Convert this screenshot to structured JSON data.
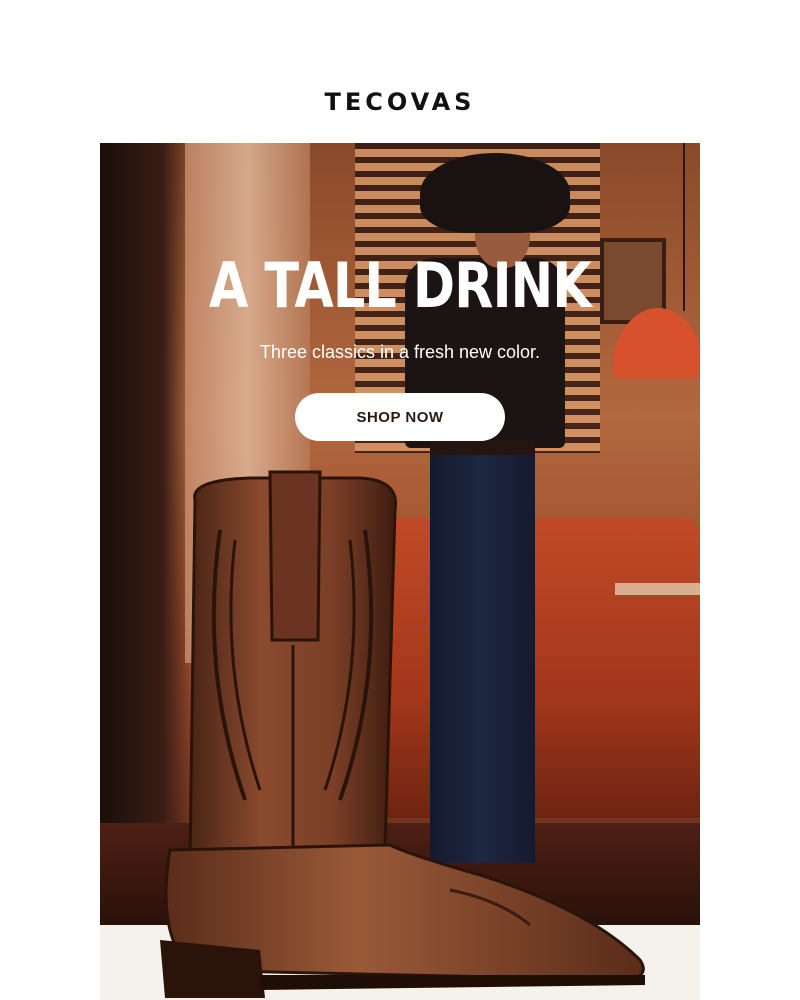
{
  "brand": {
    "logo_text": "TECOVAS"
  },
  "hero": {
    "headline": "A TALL DRINK",
    "subhead": "Three classics in a fresh new color.",
    "cta_label": "SHOP NOW"
  },
  "colors": {
    "background": "#ffffff",
    "cta_background": "#ffffff",
    "cta_text": "#2a1a12",
    "boot_leather": "#7a3f26"
  },
  "images": {
    "hero_photo": "man-in-cowboy-hat-leaning-on-diner-booth",
    "product": "brown-leather-cowboy-boot"
  }
}
